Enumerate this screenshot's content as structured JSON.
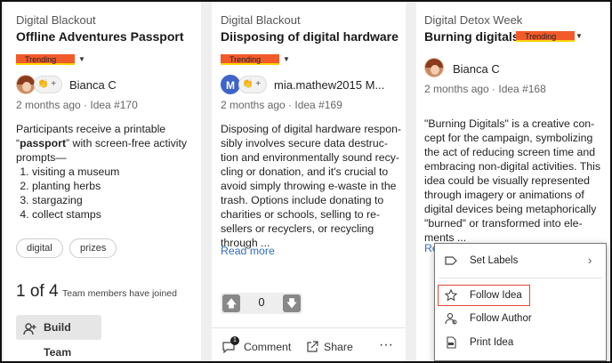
{
  "cards": [
    {
      "campaign": "Digital Blackout",
      "title": "Offline Adventures Passport",
      "trending": "Trending",
      "author": "Bianca C",
      "meta": "2 months ago · Idea #170",
      "body_intro_1": "Participants receive a printable",
      "body_quote_open": "“",
      "body_bold": "passport",
      "body_quote_close": "” with screen-free activity",
      "body_intro_3": "prompts—",
      "list": [
        "visiting a museum",
        "planting herbs",
        "stargazing",
        "collect stamps"
      ],
      "tags": [
        "digital",
        "prizes"
      ],
      "joined_count": "1 of 4",
      "joined_text": "Team members have joined",
      "build_team": "Build Team"
    },
    {
      "campaign": "Digital Blackout",
      "title": "Diisposing of digital hardware",
      "trending": "Trending",
      "avatar_initial": "M",
      "author": "mia.mathew2015 M...",
      "meta": "2 months ago · Idea #169",
      "body_lines": [
        "Disposing of digital hardware respon-",
        "sibly involves secure data destruc-",
        "tion and environmentally sound recy-",
        "cling or donation, and it's crucial to",
        "avoid simply throwing e-waste in the",
        "trash. Options include donating to",
        "charities or schools, selling to re-",
        "sellers or recyclers, or recycling",
        "through ..."
      ],
      "read_more": "Read more",
      "vote_count": "0",
      "comment_label": "Comment",
      "comment_badge": "1",
      "share_label": "Share",
      "more_label": "···"
    },
    {
      "campaign": "Digital Detox Week",
      "title": "Burning digitals",
      "trending": "Trending",
      "author": "Bianca C",
      "meta": "2 months ago · Idea #168",
      "body_lines": [
        "\"Burning Digitals\" is a creative con-",
        "cept for the campaign, symbolizing",
        "the act of reducing screen time and",
        "embracing non-digital activities. This",
        "idea could be visually represented",
        "through imagery or animations of",
        "digital devices being metaphorically",
        "\"burned\" or transformed into ele-",
        "ments ..."
      ],
      "read_more_partial": "Re"
    }
  ],
  "context_menu": {
    "items": [
      {
        "label": "Set Labels",
        "icon": "label-icon"
      },
      {
        "label": "Follow Idea",
        "icon": "star-icon"
      },
      {
        "label": "Follow Author",
        "icon": "user-follow-icon"
      },
      {
        "label": "Print Idea",
        "icon": "pdf-icon"
      }
    ]
  },
  "colors": {
    "trending": "#f15a29",
    "link": "#2e6fbf",
    "highlight": "#e0463a"
  }
}
